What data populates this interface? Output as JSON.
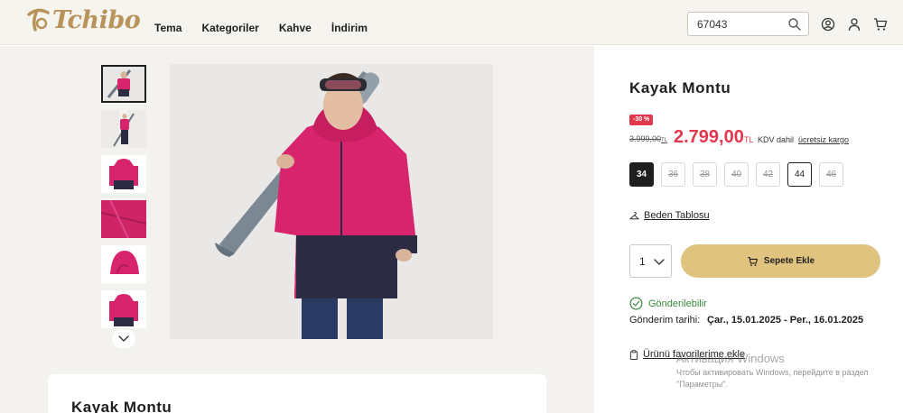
{
  "brand": {
    "logo_text": "Tchibo",
    "color": "#b8935a"
  },
  "nav": {
    "items": [
      "Tema",
      "Kategoriler",
      "Kahve",
      "İndirim"
    ]
  },
  "search": {
    "value": "67043",
    "icon": "search-icon"
  },
  "header_icons": [
    "user-circle-icon",
    "account-icon",
    "cart-icon"
  ],
  "gallery": {
    "thumbnails": [
      "front-view",
      "full-length",
      "product-front",
      "fabric-detail",
      "hood-detail",
      "back-view"
    ],
    "active_index": 0,
    "arrow_icon": "chevron-down-icon"
  },
  "product": {
    "title": "Kayak Montu",
    "discount_badge": "-30 %",
    "old_price": "3.999,00",
    "old_currency": "TL",
    "new_price": "2.799,00",
    "new_currency": "TL",
    "vat": "KDV dahil",
    "shipping_link": "ücretsiz kargo",
    "accent_color": "#e2384d"
  },
  "sizes": [
    {
      "label": "34",
      "state": "selected"
    },
    {
      "label": "36",
      "state": "out"
    },
    {
      "label": "38",
      "state": "out"
    },
    {
      "label": "40",
      "state": "out"
    },
    {
      "label": "42",
      "state": "out"
    },
    {
      "label": "44",
      "state": "available"
    },
    {
      "label": "46",
      "state": "out"
    }
  ],
  "size_chart_link": "Beden Tablosu",
  "quantity": {
    "value": "1"
  },
  "cart_button": {
    "label": "Sepete Ekle",
    "color": "#e0c37f"
  },
  "shipping": {
    "status": "Gönderilebilir",
    "date_label": "Gönderim tarihi:",
    "date_value": "Çar., 15.01.2025 - Per., 16.01.2025"
  },
  "favorites_link": "Ürünü favorilerime ekle",
  "card": {
    "title": "Kayak Montu"
  },
  "windows_watermark": {
    "line1": "Активация Windows",
    "line2": "Чтобы активировать Windows, перейдите в раздел \"Параметры\"."
  }
}
